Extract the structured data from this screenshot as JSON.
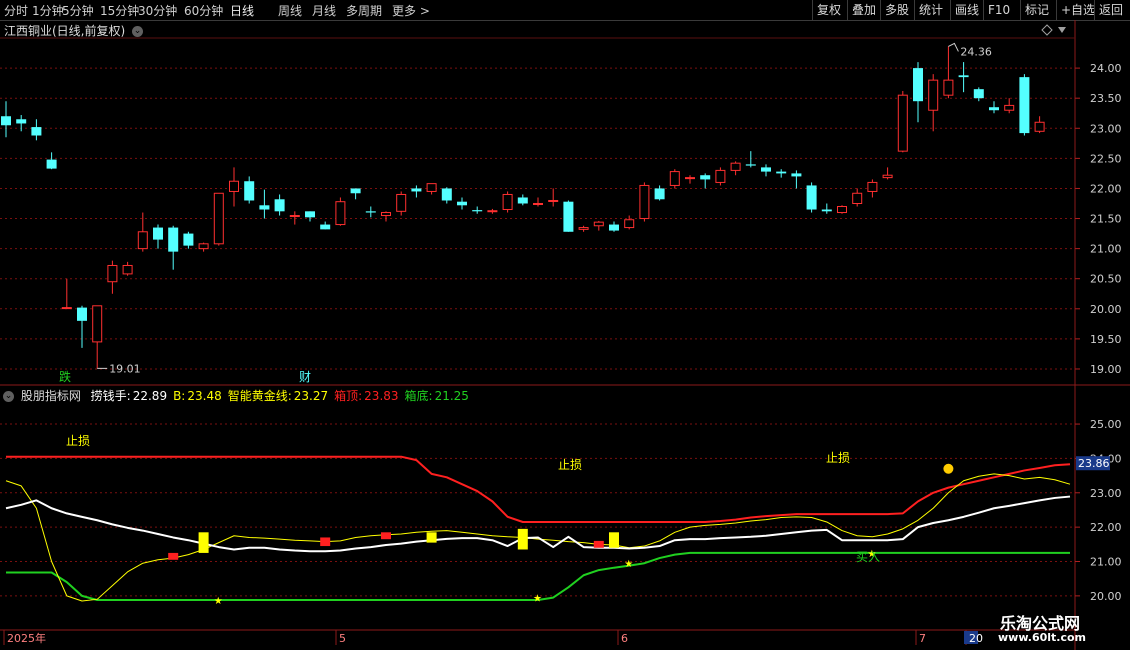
{
  "toolbar": {
    "left": [
      "分时",
      "1分钟",
      "5分钟",
      "15分钟",
      "30分钟",
      "60分钟",
      "日线",
      "周线",
      "月线",
      "多周期",
      "更多 >"
    ],
    "active": "日线",
    "right": [
      "复权",
      "叠加",
      "多股",
      "统计",
      "画线",
      "F10",
      "标记",
      "+自选",
      "返回"
    ]
  },
  "main_title": "江西铜业(日线,前复权)",
  "sub_title": {
    "name": "股朋指标网",
    "items": [
      {
        "label": "捞钱手:",
        "value": "22.89",
        "color": "#ffffff"
      },
      {
        "label": "B:",
        "value": "23.48",
        "color": "#ffff00"
      },
      {
        "label": "智能黄金线:",
        "value": "23.27",
        "color": "#ffff00"
      },
      {
        "label": "箱顶:",
        "value": "23.83",
        "color": "#ff2020"
      },
      {
        "label": "箱底:",
        "value": "21.25",
        "color": "#20d020"
      }
    ]
  },
  "colors": {
    "up": "#ff3030",
    "down": "#54ffff",
    "white": "#ffffff",
    "yellow": "#ffff00",
    "red": "#ff2020",
    "green": "#20d020",
    "grid": "#7a1010"
  },
  "chart_data": [
    {
      "type": "candlestick",
      "title": "江西铜业(日线,前复权)",
      "ylim": [
        18.85,
        24.6
      ],
      "y_ticks": [
        "24.00",
        "23.50",
        "23.00",
        "22.50",
        "22.00",
        "21.50",
        "21.00",
        "20.50",
        "20.00",
        "19.50",
        "19.00"
      ],
      "annotations": {
        "high": "24.36",
        "low": "19.01",
        "marks": [
          "跌",
          "财"
        ]
      },
      "candles": [
        {
          "o": 23.2,
          "h": 23.45,
          "l": 22.85,
          "c": 23.05
        },
        {
          "o": 23.15,
          "h": 23.22,
          "l": 22.95,
          "c": 23.08
        },
        {
          "o": 23.02,
          "h": 23.15,
          "l": 22.8,
          "c": 22.88
        },
        {
          "o": 22.48,
          "h": 22.6,
          "l": 22.32,
          "c": 22.33
        },
        {
          "o": 20.02,
          "h": 20.5,
          "l": 20.02,
          "c": 20.02
        },
        {
          "o": 20.02,
          "h": 20.05,
          "l": 19.35,
          "c": 19.8
        },
        {
          "o": 19.45,
          "h": 20.05,
          "l": 19.01,
          "c": 20.05
        },
        {
          "o": 20.45,
          "h": 20.8,
          "l": 20.25,
          "c": 20.72
        },
        {
          "o": 20.58,
          "h": 20.78,
          "l": 20.55,
          "c": 20.72
        },
        {
          "o": 21.0,
          "h": 21.6,
          "l": 20.95,
          "c": 21.28
        },
        {
          "o": 21.35,
          "h": 21.4,
          "l": 21.0,
          "c": 21.15
        },
        {
          "o": 21.35,
          "h": 21.38,
          "l": 20.65,
          "c": 20.95
        },
        {
          "o": 21.25,
          "h": 21.28,
          "l": 21.0,
          "c": 21.05
        },
        {
          "o": 21.0,
          "h": 21.1,
          "l": 20.95,
          "c": 21.08
        },
        {
          "o": 21.08,
          "h": 21.92,
          "l": 21.05,
          "c": 21.92
        },
        {
          "o": 21.95,
          "h": 22.35,
          "l": 21.7,
          "c": 22.12
        },
        {
          "o": 22.12,
          "h": 22.2,
          "l": 21.75,
          "c": 21.8
        },
        {
          "o": 21.72,
          "h": 21.98,
          "l": 21.5,
          "c": 21.65
        },
        {
          "o": 21.82,
          "h": 21.9,
          "l": 21.55,
          "c": 21.62
        },
        {
          "o": 21.55,
          "h": 21.62,
          "l": 21.4,
          "c": 21.55
        },
        {
          "o": 21.62,
          "h": 21.62,
          "l": 21.45,
          "c": 21.52
        },
        {
          "o": 21.4,
          "h": 21.45,
          "l": 21.32,
          "c": 21.32
        },
        {
          "o": 21.4,
          "h": 21.85,
          "l": 21.38,
          "c": 21.78
        },
        {
          "o": 22.0,
          "h": 22.0,
          "l": 21.82,
          "c": 21.92
        },
        {
          "o": 21.62,
          "h": 21.7,
          "l": 21.52,
          "c": 21.6
        },
        {
          "o": 21.55,
          "h": 21.62,
          "l": 21.45,
          "c": 21.6
        },
        {
          "o": 21.62,
          "h": 21.95,
          "l": 21.55,
          "c": 21.9
        },
        {
          "o": 22.0,
          "h": 22.05,
          "l": 21.85,
          "c": 21.95
        },
        {
          "o": 21.95,
          "h": 22.08,
          "l": 21.9,
          "c": 22.08
        },
        {
          "o": 22.0,
          "h": 22.02,
          "l": 21.75,
          "c": 21.8
        },
        {
          "o": 21.78,
          "h": 21.85,
          "l": 21.65,
          "c": 21.72
        },
        {
          "o": 21.64,
          "h": 21.7,
          "l": 21.58,
          "c": 21.62
        },
        {
          "o": 21.63,
          "h": 21.66,
          "l": 21.58,
          "c": 21.63
        },
        {
          "o": 21.65,
          "h": 21.95,
          "l": 21.6,
          "c": 21.9
        },
        {
          "o": 21.85,
          "h": 21.9,
          "l": 21.72,
          "c": 21.75
        },
        {
          "o": 21.75,
          "h": 21.85,
          "l": 21.7,
          "c": 21.75
        },
        {
          "o": 21.8,
          "h": 22.0,
          "l": 21.7,
          "c": 21.8
        },
        {
          "o": 21.78,
          "h": 21.8,
          "l": 21.28,
          "c": 21.28
        },
        {
          "o": 21.32,
          "h": 21.38,
          "l": 21.28,
          "c": 21.35
        },
        {
          "o": 21.38,
          "h": 21.46,
          "l": 21.3,
          "c": 21.44
        },
        {
          "o": 21.4,
          "h": 21.45,
          "l": 21.28,
          "c": 21.3
        },
        {
          "o": 21.35,
          "h": 21.55,
          "l": 21.32,
          "c": 21.48
        },
        {
          "o": 21.5,
          "h": 22.1,
          "l": 21.45,
          "c": 22.05
        },
        {
          "o": 22.0,
          "h": 22.05,
          "l": 21.8,
          "c": 21.82
        },
        {
          "o": 22.05,
          "h": 22.32,
          "l": 22.0,
          "c": 22.28
        },
        {
          "o": 22.18,
          "h": 22.22,
          "l": 22.08,
          "c": 22.18
        },
        {
          "o": 22.22,
          "h": 22.25,
          "l": 22.0,
          "c": 22.15
        },
        {
          "o": 22.1,
          "h": 22.35,
          "l": 22.05,
          "c": 22.3
        },
        {
          "o": 22.3,
          "h": 22.45,
          "l": 22.22,
          "c": 22.42
        },
        {
          "o": 22.4,
          "h": 22.62,
          "l": 22.35,
          "c": 22.38
        },
        {
          "o": 22.35,
          "h": 22.4,
          "l": 22.2,
          "c": 22.28
        },
        {
          "o": 22.28,
          "h": 22.32,
          "l": 22.18,
          "c": 22.25
        },
        {
          "o": 22.25,
          "h": 22.3,
          "l": 22.0,
          "c": 22.2
        },
        {
          "o": 22.05,
          "h": 22.1,
          "l": 21.6,
          "c": 21.65
        },
        {
          "o": 21.65,
          "h": 21.75,
          "l": 21.58,
          "c": 21.62
        },
        {
          "o": 21.6,
          "h": 21.72,
          "l": 21.58,
          "c": 21.7
        },
        {
          "o": 21.75,
          "h": 22.0,
          "l": 21.7,
          "c": 21.92
        },
        {
          "o": 21.95,
          "h": 22.15,
          "l": 21.85,
          "c": 22.1
        },
        {
          "o": 22.18,
          "h": 22.35,
          "l": 22.15,
          "c": 22.22
        },
        {
          "o": 22.62,
          "h": 23.62,
          "l": 22.6,
          "c": 23.55
        },
        {
          "o": 24.0,
          "h": 24.1,
          "l": 23.1,
          "c": 23.45
        },
        {
          "o": 23.3,
          "h": 23.9,
          "l": 22.95,
          "c": 23.8
        },
        {
          "o": 23.55,
          "h": 24.36,
          "l": 23.5,
          "c": 23.8
        },
        {
          "o": 23.88,
          "h": 24.1,
          "l": 23.6,
          "c": 23.85
        },
        {
          "o": 23.65,
          "h": 23.68,
          "l": 23.45,
          "c": 23.5
        },
        {
          "o": 23.35,
          "h": 23.45,
          "l": 23.25,
          "c": 23.3
        },
        {
          "o": 23.3,
          "h": 23.5,
          "l": 23.25,
          "c": 23.38
        },
        {
          "o": 23.85,
          "h": 23.9,
          "l": 22.88,
          "c": 22.92
        },
        {
          "o": 22.95,
          "h": 23.2,
          "l": 22.92,
          "c": 23.1
        }
      ]
    },
    {
      "type": "line",
      "title": "股朋指标网",
      "ylim": [
        19.88,
        25.7
      ],
      "y_ticks": [
        "25.00",
        "24.00",
        "23.00",
        "22.00",
        "21.00",
        "20.00"
      ],
      "current_value_tag": "23.86",
      "x_labels": [
        "2025年",
        "5",
        "6",
        "7",
        "20"
      ],
      "annotations": [
        "止损",
        "止损",
        "止损",
        "买入"
      ],
      "series": [
        {
          "name": "捞钱手",
          "color": "#ffffff",
          "values": [
            22.55,
            22.65,
            22.78,
            22.55,
            22.4,
            22.3,
            22.2,
            22.08,
            21.98,
            21.9,
            21.8,
            21.7,
            21.62,
            21.52,
            21.42,
            21.35,
            21.4,
            21.4,
            21.35,
            21.32,
            21.3,
            21.3,
            21.32,
            21.38,
            21.42,
            21.48,
            21.52,
            21.58,
            21.62,
            21.66,
            21.68,
            21.68,
            21.62,
            21.45,
            21.68,
            21.7,
            21.42,
            21.72,
            21.42,
            21.4,
            21.4,
            21.38,
            21.4,
            21.45,
            21.62,
            21.65,
            21.65,
            21.68,
            21.7,
            21.72,
            21.75,
            21.8,
            21.85,
            21.9,
            21.92,
            21.62,
            21.62,
            21.62,
            21.62,
            21.65,
            22.0,
            22.12,
            22.2,
            22.3,
            22.42,
            22.55,
            22.62,
            22.7,
            22.78,
            22.85,
            22.89
          ]
        },
        {
          "name": "B",
          "color": "#ffff00",
          "values": [
            23.35,
            23.2,
            22.55,
            21.0,
            20.0,
            19.85,
            19.9,
            20.3,
            20.7,
            20.95,
            21.05,
            21.1,
            21.2,
            21.35,
            21.55,
            21.75,
            21.7,
            21.68,
            21.65,
            21.62,
            21.6,
            21.58,
            21.6,
            21.7,
            21.75,
            21.78,
            21.8,
            21.85,
            21.88,
            21.9,
            21.85,
            21.8,
            21.75,
            21.72,
            21.7,
            21.65,
            21.62,
            21.58,
            21.55,
            21.5,
            21.48,
            21.4,
            21.45,
            21.6,
            21.85,
            22.0,
            22.05,
            22.08,
            22.12,
            22.18,
            22.22,
            22.28,
            22.3,
            22.28,
            22.15,
            21.9,
            21.75,
            21.72,
            21.8,
            21.95,
            22.2,
            22.55,
            23.0,
            23.35,
            23.48,
            23.55,
            23.5,
            23.4,
            23.45,
            23.38,
            23.25
          ]
        },
        {
          "name": "箱顶",
          "color": "#ff2020",
          "values": [
            24.05,
            24.05,
            24.05,
            24.05,
            24.05,
            24.05,
            24.05,
            24.05,
            24.05,
            24.05,
            24.05,
            24.05,
            24.05,
            24.05,
            24.05,
            24.05,
            24.05,
            24.05,
            24.05,
            24.05,
            24.05,
            24.05,
            24.05,
            24.05,
            24.05,
            24.05,
            24.05,
            23.95,
            23.55,
            23.45,
            23.25,
            23.05,
            22.75,
            22.3,
            22.15,
            22.15,
            22.15,
            22.15,
            22.15,
            22.15,
            22.15,
            22.15,
            22.15,
            22.15,
            22.15,
            22.15,
            22.15,
            22.18,
            22.22,
            22.28,
            22.32,
            22.35,
            22.38,
            22.38,
            22.38,
            22.38,
            22.38,
            22.38,
            22.38,
            22.4,
            22.75,
            23.0,
            23.15,
            23.25,
            23.35,
            23.45,
            23.55,
            23.65,
            23.72,
            23.8,
            23.83
          ]
        },
        {
          "name": "箱底",
          "color": "#20d020",
          "values": [
            20.68,
            20.68,
            20.68,
            20.68,
            20.4,
            20.0,
            19.88,
            19.88,
            19.88,
            19.88,
            19.88,
            19.88,
            19.88,
            19.88,
            19.88,
            19.88,
            19.88,
            19.88,
            19.88,
            19.88,
            19.88,
            19.88,
            19.88,
            19.88,
            19.88,
            19.88,
            19.88,
            19.88,
            19.88,
            19.88,
            19.88,
            19.88,
            19.88,
            19.88,
            19.88,
            19.88,
            19.95,
            20.25,
            20.6,
            20.75,
            20.82,
            20.88,
            20.95,
            21.1,
            21.2,
            21.25,
            21.25,
            21.25,
            21.25,
            21.25,
            21.25,
            21.25,
            21.25,
            21.25,
            21.25,
            21.25,
            21.25,
            21.25,
            21.25,
            21.25,
            21.25,
            21.25,
            21.25,
            21.25,
            21.25,
            21.25,
            21.25,
            21.25,
            21.25,
            21.25,
            21.25
          ]
        }
      ]
    }
  ],
  "watermark": {
    "line1": "乐淘公式网",
    "line2": "www.60lt.com"
  }
}
